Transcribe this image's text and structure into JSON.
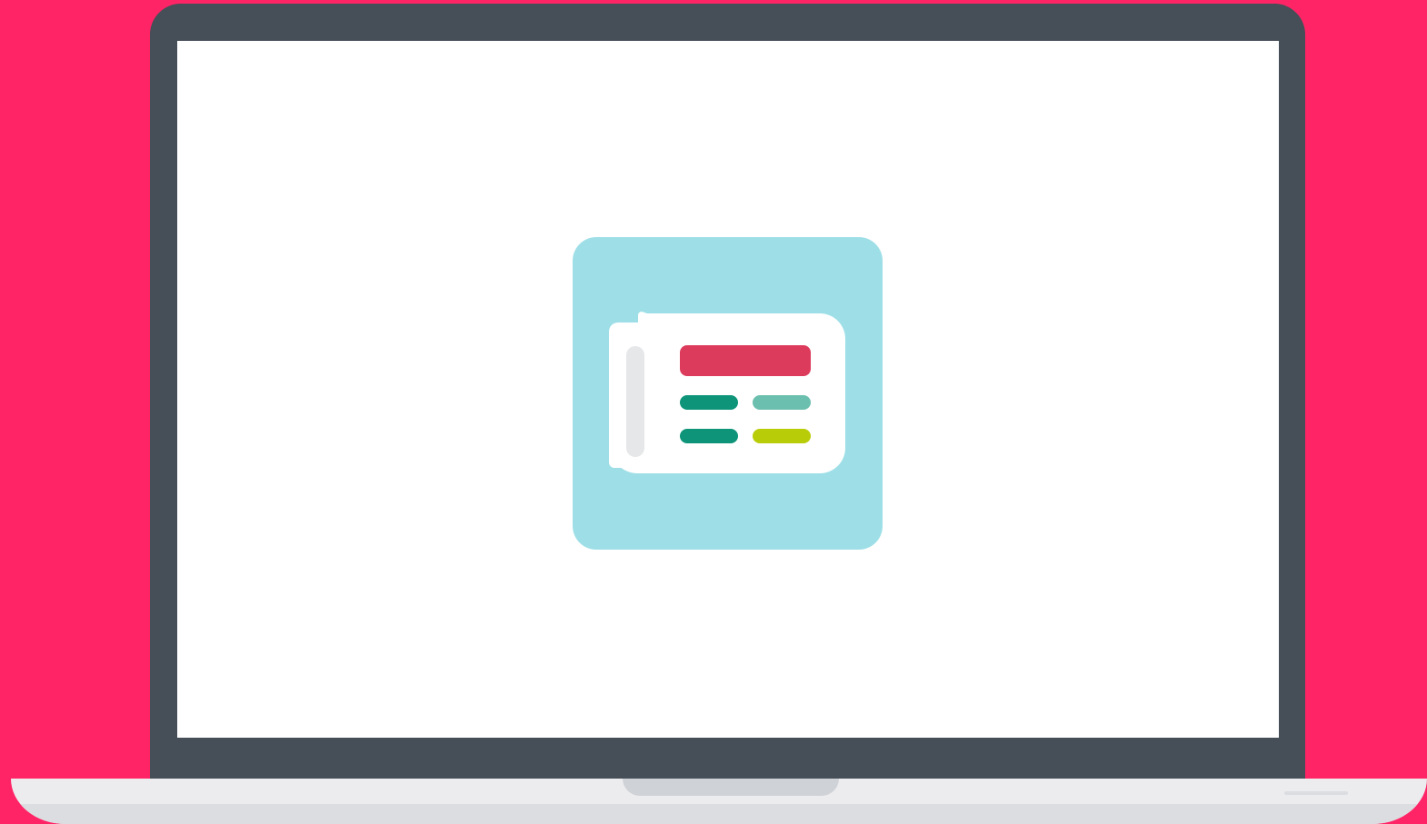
{
  "colors": {
    "background": "#ff2466",
    "laptop_bezel": "#464e58",
    "screen": "#ffffff",
    "laptop_base": "#ececee",
    "laptop_base_shade": "#dcdde0",
    "notch": "#cfd2d6",
    "app_tile": "#9edfe7",
    "paper": "#ffffff",
    "paper_fold": "#e6e7e9",
    "headline_bar": "#dd3b5c",
    "line_dark_teal": "#0d9479",
    "line_light_teal": "#6bbfae",
    "line_lime": "#b9cc08"
  },
  "icons": {
    "app_tile": "news-app-icon",
    "newspaper": "newspaper-icon"
  }
}
